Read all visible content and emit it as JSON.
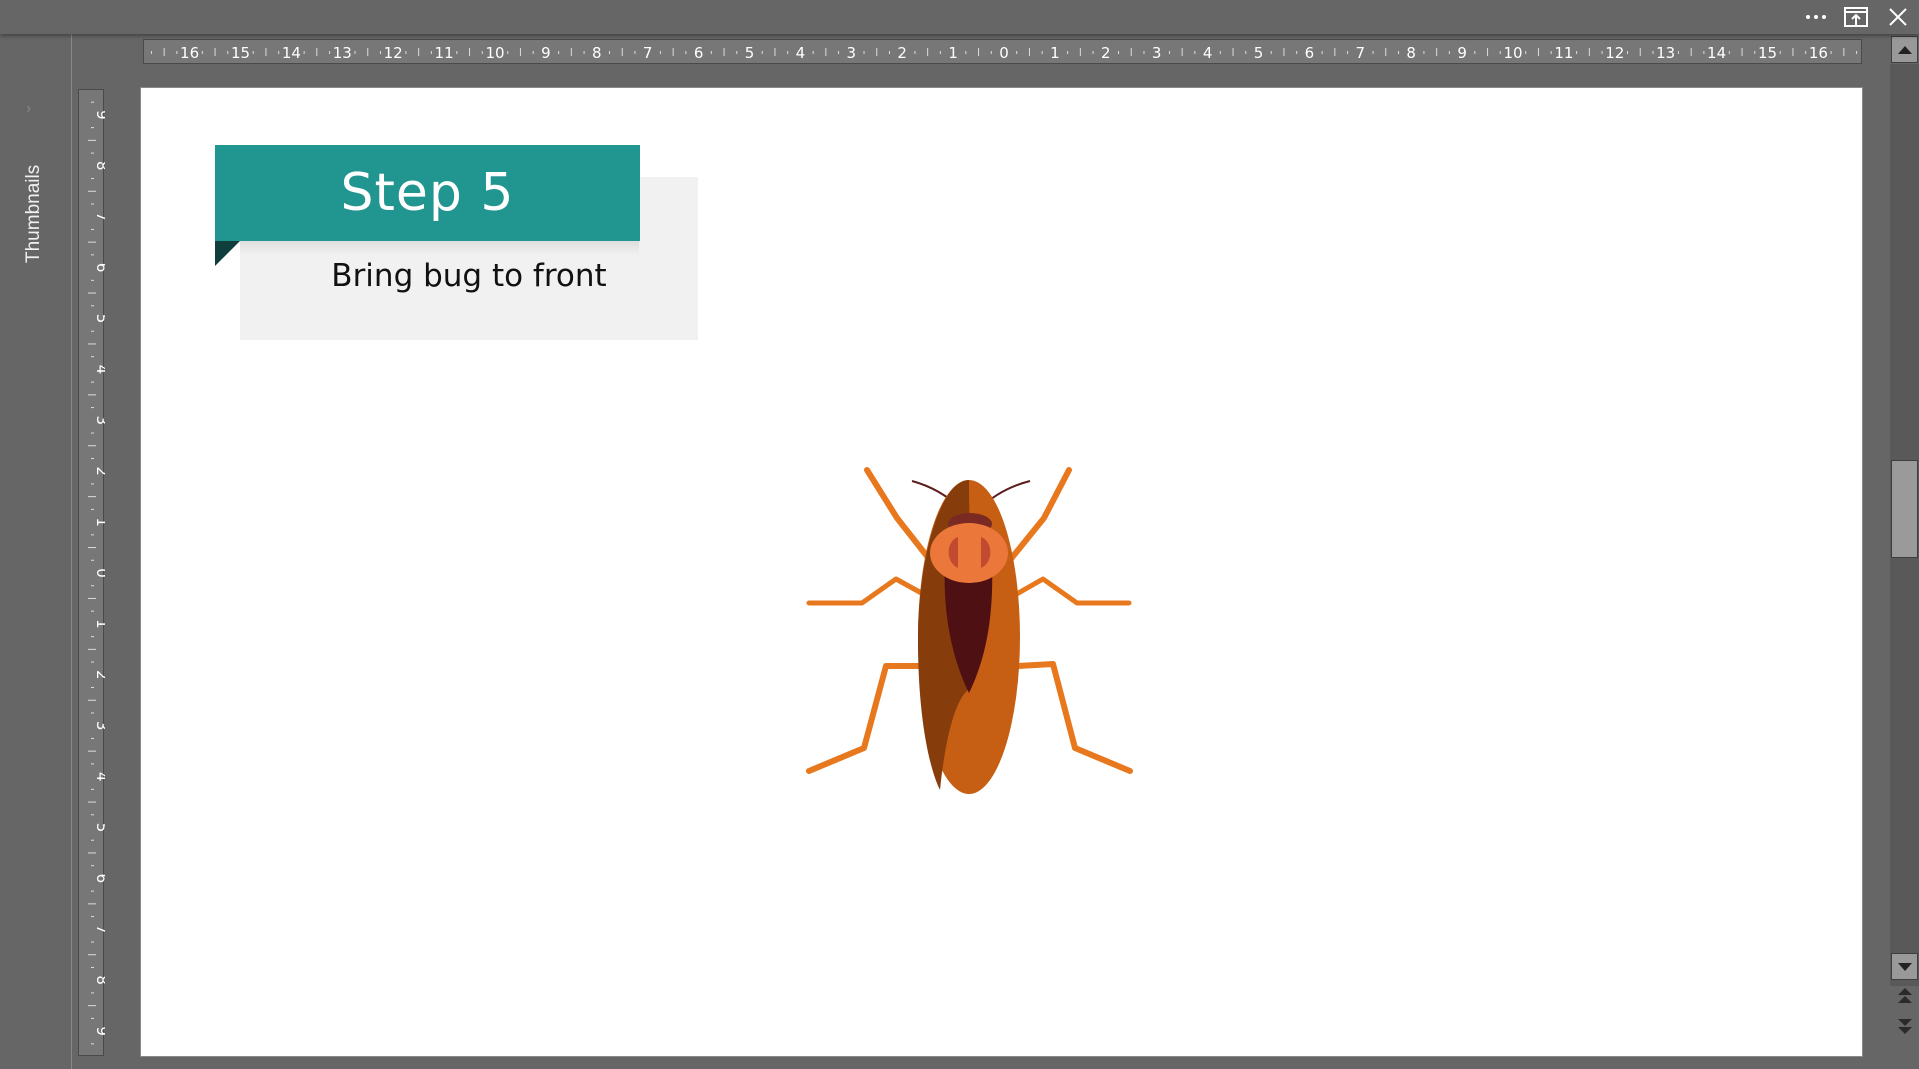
{
  "window": {
    "controls": [
      {
        "name": "more-options",
        "icon": "ellipsis-icon"
      },
      {
        "name": "present",
        "icon": "present-icon"
      },
      {
        "name": "close",
        "icon": "close-icon"
      }
    ]
  },
  "left_panel": {
    "label": "Thumbnails",
    "expand_icon": "chevron-right-icon"
  },
  "rulers": {
    "horizontal_labels": [
      "16",
      "15",
      "14",
      "13",
      "12",
      "11",
      "10",
      "9",
      "8",
      "7",
      "6",
      "5",
      "4",
      "3",
      "2",
      "1",
      "0",
      "1",
      "2",
      "3",
      "4",
      "5",
      "6",
      "7",
      "8",
      "9",
      "10",
      "11",
      "12",
      "13",
      "14",
      "15",
      "16"
    ],
    "vertical_labels": [
      "9",
      "8",
      "7",
      "6",
      "5",
      "4",
      "3",
      "2",
      "1",
      "0",
      "1",
      "2",
      "3",
      "4",
      "5",
      "6",
      "7",
      "8",
      "9"
    ]
  },
  "slide": {
    "step_title": "Step 5",
    "step_description": "Bring bug to front",
    "image": "cockroach-illustration",
    "colors": {
      "banner": "#21958f",
      "banner_fold": "#0f3e3c",
      "card": "#f1f1f1",
      "leg": "#e8781e",
      "pronotum": "#eb773a",
      "pronotum_marks": "#c24a2e",
      "head": "#7a2a22",
      "antenna": "#5c1c1c",
      "wing_left": "#873c0c",
      "wing_right": "#c65f13",
      "abdomen": "#4e1012"
    }
  },
  "scrollbar": {
    "up_icon": "arrow-up-icon",
    "down_icon": "arrow-down-icon",
    "prev_slide_icon": "double-chevron-up-icon",
    "next_slide_icon": "double-chevron-down-icon"
  }
}
